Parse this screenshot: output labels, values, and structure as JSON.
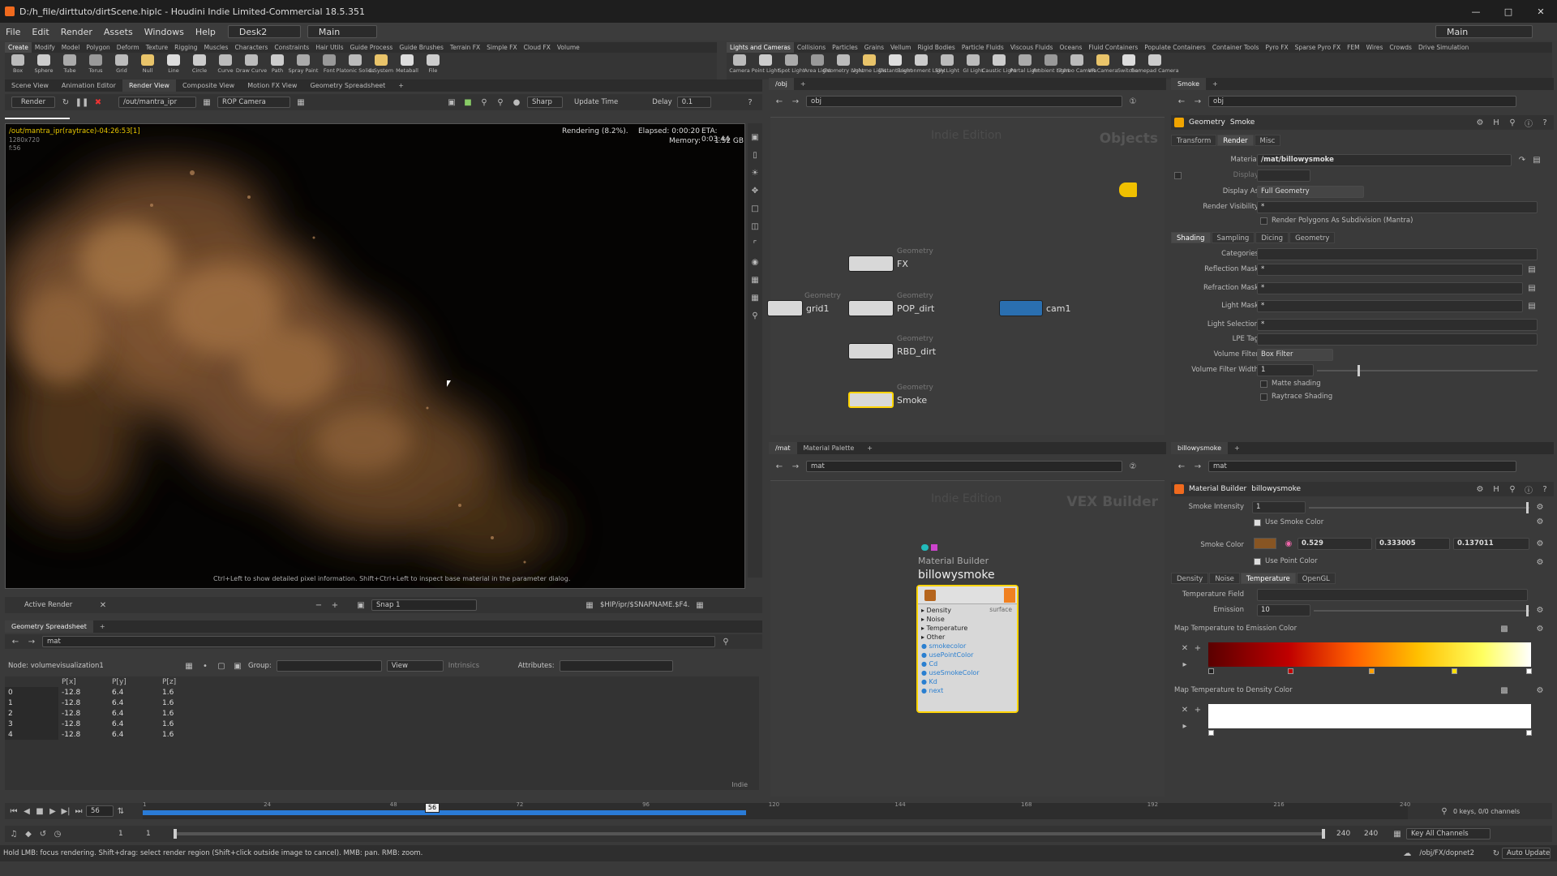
{
  "window": {
    "title": "D:/h_file/dirttuto/dirtScene.hiplc - Houdini Indie Limited-Commercial 18.5.351"
  },
  "menu": [
    "File",
    "Edit",
    "Render",
    "Assets",
    "Windows",
    "Help"
  ],
  "desk": "Desk2",
  "main_label": "Main",
  "shelf_left": {
    "tabs": [
      "Create",
      "Modify",
      "Model",
      "Polygon",
      "Deform",
      "Texture",
      "Rigging",
      "Muscles",
      "Characters",
      "Constraints",
      "Hair Utils",
      "Guide Process",
      "Guide Brushes",
      "Terrain FX",
      "Simple FX",
      "Cloud FX",
      "Volume"
    ],
    "tools": [
      "Box",
      "Sphere",
      "Tube",
      "Torus",
      "Grid",
      "Null",
      "Line",
      "Circle",
      "Curve",
      "Draw Curve",
      "Path",
      "Spray Paint",
      "Font",
      "Platonic Solids",
      "L-System",
      "Metaball",
      "File"
    ]
  },
  "shelf_right": {
    "tabs": [
      "Lights and Cameras",
      "Collisions",
      "Particles",
      "Grains",
      "Vellum",
      "Rigid Bodies",
      "Particle Fluids",
      "Viscous Fluids",
      "Oceans",
      "Fluid Containers",
      "Populate Containers",
      "Container Tools",
      "Pyro FX",
      "Sparse Pyro FX",
      "FEM",
      "Wires",
      "Crowds",
      "Drive Simulation"
    ],
    "tools": [
      "Camera",
      "Point Light",
      "Spot Light",
      "Area Light",
      "Geometry Light",
      "Volume Light",
      "Distant Light",
      "Environment Light",
      "Sky Light",
      "GI Light",
      "Caustic Light",
      "Portal Light",
      "Ambient Light",
      "Stereo Camera",
      "VR Camera",
      "Switcher",
      "Gamepad Camera"
    ]
  },
  "render_view": {
    "tabs": [
      "Scene View",
      "Animation Editor",
      "Render View",
      "Composite View",
      "Motion FX View",
      "Geometry Spreadsheet"
    ],
    "render_btn": "Render",
    "rop": "/out/mantra_ipr",
    "camera": "ROP Camera",
    "sharp": "Sharp",
    "update_time": "Update Time",
    "delay_label": "Delay",
    "delay_value": "0.1",
    "overlay_path": "/out/mantra_ipr(raytrace)-04:26:53[1]",
    "overlay_res": "1280x720",
    "overlay_frame": "f:56",
    "status": "Rendering (8.2%).",
    "elapsed": "Elapsed: 0:00:20",
    "eta": "ETA: 0:03:44",
    "memory": "Memory:",
    "memory_value": "1.52 GB",
    "hint": "Ctrl+Left to show detailed pixel information. Shift+Ctrl+Left to inspect base material in the parameter dialog.",
    "active_render": "Active Render",
    "snap": "Snap 1",
    "snap_path": "$HIP/ipr/$SNAPNAME.$F4.$"
  },
  "spreadsheet": {
    "tab": "Geometry Spreadsheet",
    "path": "mat",
    "node_label": "Node: volumevisualization1",
    "group_label": "Group:",
    "view_label": "View",
    "intrinsics": "Intrinsics",
    "attributes_label": "Attributes:",
    "columns": [
      "",
      "P[x]",
      "P[y]",
      "P[z]"
    ],
    "rows": [
      [
        "0",
        "-12.8",
        "6.4",
        "1.6"
      ],
      [
        "1",
        "-12.8",
        "6.4",
        "1.6"
      ],
      [
        "2",
        "-12.8",
        "6.4",
        "1.6"
      ],
      [
        "3",
        "-12.8",
        "6.4",
        "1.6"
      ],
      [
        "4",
        "-12.8",
        "6.4",
        "1.6"
      ]
    ],
    "indie": "Indie"
  },
  "network_obj": {
    "tab": "/obj",
    "path": "obj",
    "watermark": "Indie Edition",
    "context": "Objects",
    "nodes": [
      {
        "name": "FX",
        "type": "Geometry"
      },
      {
        "name": "grid1",
        "type": "Geometry"
      },
      {
        "name": "POP_dirt",
        "type": "Geometry"
      },
      {
        "name": "RBD_dirt",
        "type": "Geometry"
      },
      {
        "name": "Smoke",
        "type": "Geometry"
      },
      {
        "name": "cam1",
        "type": ""
      }
    ]
  },
  "params_obj": {
    "tab": "Smoke",
    "path": "obj",
    "node_type": "Geometry",
    "node_name": "Smoke",
    "tabs": [
      "Transform",
      "Render",
      "Misc"
    ],
    "material_label": "Material",
    "material": "/mat/billowysmoke",
    "display_label": "Display",
    "display_as_label": "Display As",
    "display_as": "Full Geometry",
    "render_visibility_label": "Render Visibility",
    "render_visibility": "*",
    "subdivision": "Render Polygons As Subdivision (Mantra)",
    "subtabs": [
      "Shading",
      "Sampling",
      "Dicing",
      "Geometry"
    ],
    "categories_label": "Categories",
    "reflection_mask_label": "Reflection Mask",
    "reflection_mask": "*",
    "refraction_mask_label": "Refraction Mask",
    "refraction_mask": "*",
    "light_mask_label": "Light Mask",
    "light_mask": "*",
    "light_selection_label": "Light Selection",
    "light_selection": "*",
    "lpe_label": "LPE Tag",
    "volume_filter_label": "Volume Filter",
    "volume_filter": "Box Filter",
    "volume_filter_width_label": "Volume Filter Width",
    "volume_filter_width": "1",
    "matte": "Matte shading",
    "raytrace": "Raytrace Shading"
  },
  "network_mat": {
    "tab": "/mat",
    "tab2": "Material Palette",
    "path": "mat",
    "watermark": "Indie Edition",
    "context": "VEX Builder",
    "node_type": "Material Builder",
    "node_name": "billowysmoke",
    "output": "surface",
    "inputs": [
      "Density",
      "Noise",
      "Temperature",
      "Other"
    ],
    "params": [
      "smokecolor",
      "usePointColor",
      "Cd",
      "useSmokeColor",
      "Kd",
      "next"
    ]
  },
  "params_mat": {
    "tab": "billowysmoke",
    "path": "mat",
    "node_type": "Material Builder",
    "node_name": "billowysmoke",
    "smoke_intensity_label": "Smoke Intensity",
    "smoke_intensity": "1",
    "use_smoke_color": "Use Smoke Color",
    "smoke_color_label": "Smoke Color",
    "smoke_color_r": "0.529",
    "smoke_color_g": "0.333005",
    "smoke_color_b": "0.137011",
    "use_point_color": "Use Point Color",
    "tabs": [
      "Density",
      "Noise",
      "Temperature",
      "OpenGL"
    ],
    "temperature_field_label": "Temperature Field",
    "emission_label": "Emission",
    "emission": "10",
    "ramp1_label": "Map Temperature to Emission Color",
    "ramp2_label": "Map Temperature to Density Color"
  },
  "timeline": {
    "frame": "56",
    "ticks": [
      "1",
      "24",
      "48",
      "72",
      "96",
      "120",
      "144",
      "168",
      "192",
      "216",
      "240"
    ],
    "start": "1",
    "start2": "1",
    "end": "240",
    "end2": "240",
    "keys": "0 keys, 0/0 channels",
    "key_all": "Key All Channels"
  },
  "statusbar": {
    "text": "Hold LMB: focus rendering. Shift+drag: select render region (Shift+click outside image to cancel). MMB: pan. RMB: zoom.",
    "path": "/obj/FX/dopnet2",
    "auto_update": "Auto Update"
  },
  "colors": {
    "accent": "#f0a400",
    "timeline": "#2a7bd6",
    "smoke": "#87552e"
  }
}
